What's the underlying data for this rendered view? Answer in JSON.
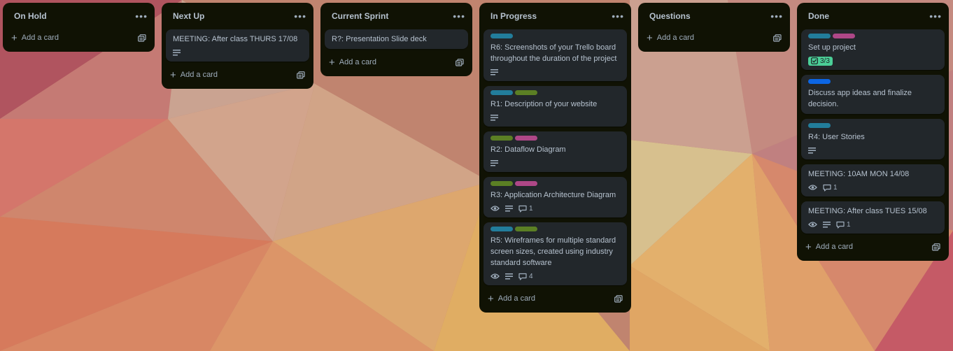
{
  "colors": {
    "teal": "#227d9b",
    "green": "#5b7f24",
    "magenta": "#ae4787",
    "blue": "#0c66e4",
    "list_bg": "#101204",
    "card_bg": "#22272b"
  },
  "add_card_label": "Add a card",
  "lists": [
    {
      "title": "On Hold",
      "cards": []
    },
    {
      "title": "Next Up",
      "cards": [
        {
          "title": "MEETING: After class THURS 17/08",
          "labels": [],
          "description": true
        }
      ]
    },
    {
      "title": "Current Sprint",
      "cards": [
        {
          "title": "R?: Presentation Slide deck",
          "labels": [],
          "description": false
        }
      ]
    },
    {
      "title": "In Progress",
      "cards": [
        {
          "title": "R6: Screenshots of your Trello board throughout the duration of the project",
          "labels": [
            "teal"
          ],
          "description": true
        },
        {
          "title": "R1: Description of your website",
          "labels": [
            "teal",
            "green"
          ],
          "description": true
        },
        {
          "title": "R2: Dataflow Diagram",
          "labels": [
            "green",
            "magenta"
          ],
          "description": true
        },
        {
          "title": "R3: Application Architecture Diagram",
          "labels": [
            "green",
            "magenta"
          ],
          "watching": true,
          "description": true,
          "comments": "1"
        },
        {
          "title": "R5: Wireframes for multiple standard screen sizes, created using industry standard software",
          "labels": [
            "teal",
            "green"
          ],
          "watching": true,
          "description": true,
          "comments": "4"
        }
      ]
    },
    {
      "title": "Questions",
      "cards": []
    },
    {
      "title": "Done",
      "cards": [
        {
          "title": "Set up project",
          "labels": [
            "teal",
            "magenta"
          ],
          "checklist": "3/3"
        },
        {
          "title": "Discuss app ideas and finalize decision.",
          "labels": [
            "blue"
          ]
        },
        {
          "title": "R4: User Stories",
          "labels": [
            "teal"
          ],
          "description": true
        },
        {
          "title": "MEETING: 10AM MON 14/08",
          "labels": [],
          "watching": true,
          "comments": "1"
        },
        {
          "title": "MEETING: After class TUES 15/08",
          "labels": [],
          "watching": true,
          "description": true,
          "comments": "1"
        }
      ]
    }
  ]
}
